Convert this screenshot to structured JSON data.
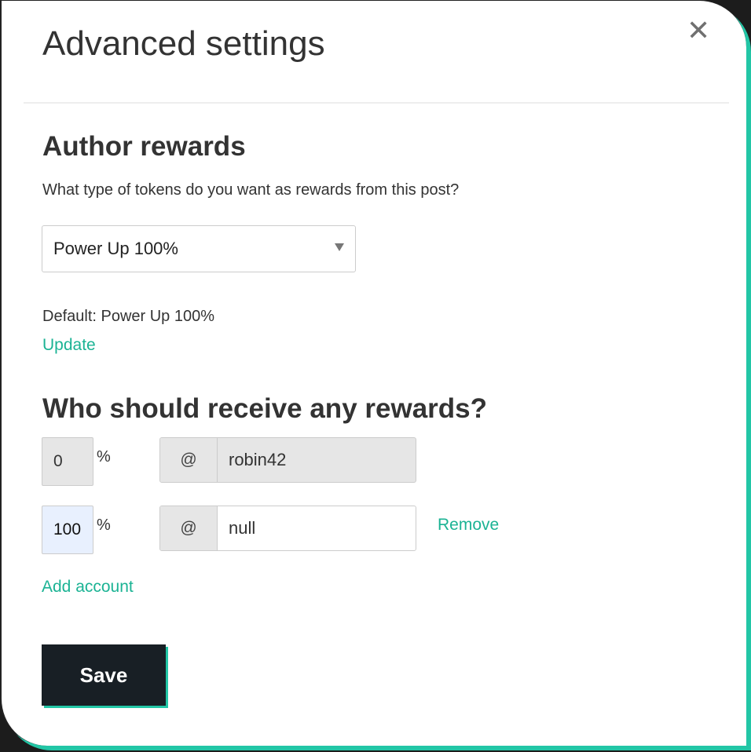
{
  "modal": {
    "title": "Advanced settings",
    "close_icon": "close-icon"
  },
  "author_rewards": {
    "heading": "Author rewards",
    "question": "What type of tokens do you want as rewards from this post?",
    "selected": "Power Up 100%",
    "default_text": "Default: Power Up 100%",
    "update_label": "Update"
  },
  "beneficiaries": {
    "heading": "Who should receive any rewards?",
    "rows": [
      {
        "percent": "0",
        "percent_symbol": "%",
        "at": "@",
        "account": "robin42",
        "editable": false
      },
      {
        "percent": "100",
        "percent_symbol": "%",
        "at": "@",
        "account": "null",
        "editable": true,
        "remove_label": "Remove"
      }
    ],
    "add_label": "Add account"
  },
  "save_label": "Save",
  "colors": {
    "accent": "#1bb394",
    "shadow": "#22c6a6",
    "button": "#181f25"
  }
}
